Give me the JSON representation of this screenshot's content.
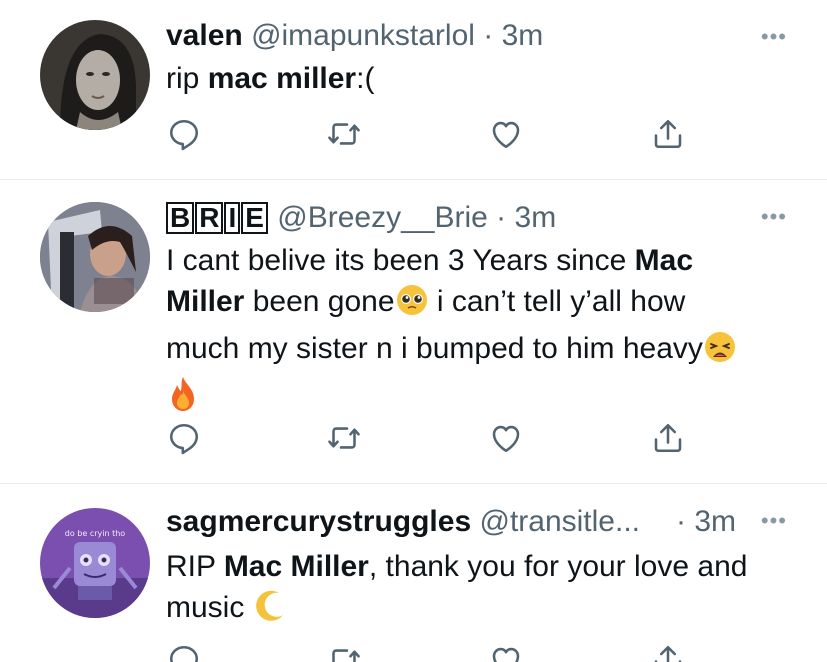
{
  "tweets": [
    {
      "name": "valen",
      "handle": "@imapunkstarlol",
      "dot": "·",
      "time": "3m",
      "more": "•••",
      "text_parts": [
        "rip ",
        "mac miller",
        ":("
      ]
    },
    {
      "name_letters": [
        "B",
        "R",
        "I",
        "E"
      ],
      "handle": "@Breezy__Brie",
      "dot": "·",
      "time": "3m",
      "more": "•••",
      "line1_pre": "I cant belive its been 3 Years since ",
      "line1_bold": "Mac",
      "line2_bold": "Miller",
      "line2_post": " been gone",
      "line2_tail": " i can’t tell y’all how",
      "line3": "much my sister n i bumped to him heavy"
    },
    {
      "name": "sagmercurystruggles",
      "handle": "@transitle...",
      "dot": "·",
      "time": "3m",
      "more": "•••",
      "text_pre": "RIP ",
      "text_bold": "Mac Miller",
      "text_post": ", thank you for your love and",
      "line2": "music",
      "avatar_caption": "do be cryin tho"
    }
  ],
  "icons": [
    "reply-icon",
    "retweet-icon",
    "like-icon",
    "share-icon"
  ],
  "colors": {
    "text": "#0f1419",
    "secondary": "#536471",
    "divider": "#e6ecf0"
  }
}
